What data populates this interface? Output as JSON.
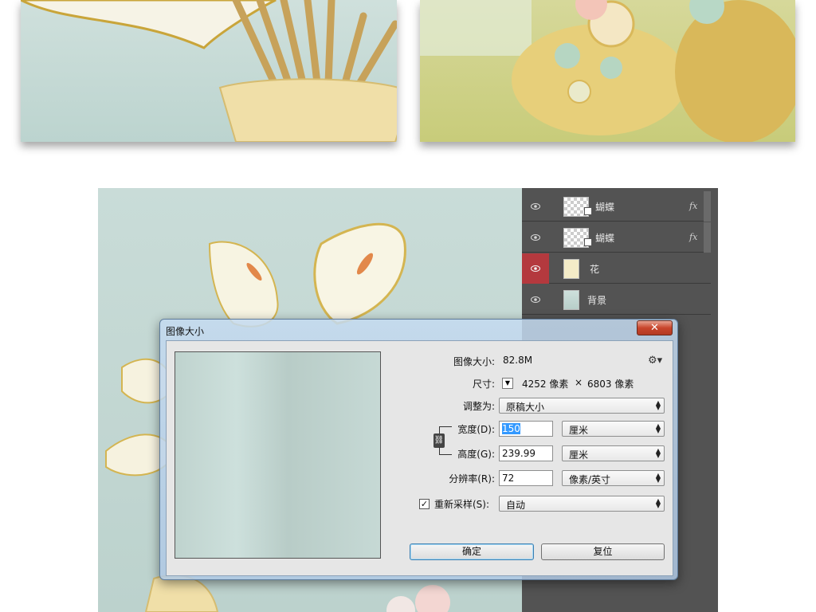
{
  "layers": [
    {
      "name": "蝴蝶",
      "fx": "fx",
      "active": false,
      "thumb": "checker"
    },
    {
      "name": "蝴蝶",
      "fx": "fx",
      "active": false,
      "thumb": "checker"
    },
    {
      "name": "花",
      "fx": "",
      "active": true,
      "thumb": "flower"
    },
    {
      "name": "背景",
      "fx": "",
      "active": false,
      "thumb": "background"
    }
  ],
  "dialog": {
    "title": "图像大小",
    "close_label": "✕",
    "image_size_label": "图像大小:",
    "image_size_value": "82.8M",
    "dimensions_label": "尺寸:",
    "dimensions_width": "4252 像素",
    "dimensions_x": "×",
    "dimensions_height": "6803 像素",
    "fit_to_label": "调整为:",
    "fit_to_value": "原稿大小",
    "width_label": "宽度(D):",
    "width_value": "150",
    "width_unit": "厘米",
    "height_label": "高度(G):",
    "height_value": "239.99",
    "height_unit": "厘米",
    "resolution_label": "分辨率(R):",
    "resolution_value": "72",
    "resolution_unit": "像素/英寸",
    "resample_label": "重新采样(S):",
    "resample_checked": true,
    "resample_value": "自动",
    "ok_label": "确定",
    "reset_label": "复位"
  },
  "colors": {
    "active_eye": "#b4393e",
    "layers_bg": "#535353",
    "dialog_frame": "#c4daf0"
  }
}
